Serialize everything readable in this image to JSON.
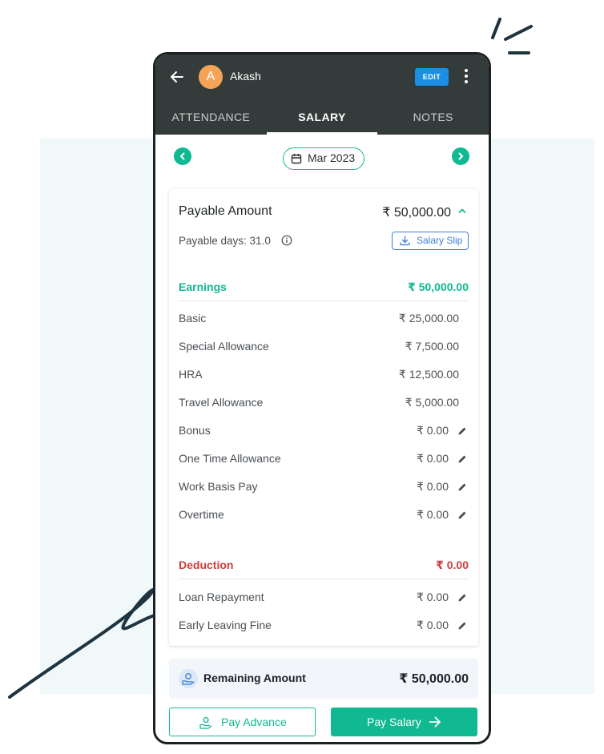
{
  "header": {
    "avatar_initial": "A",
    "user_name": "Akash",
    "edit_label": "EDIT",
    "icons": {
      "back": "arrow-left-icon",
      "menu": "more-vertical-icon"
    }
  },
  "tabs": [
    {
      "label": "ATTENDANCE",
      "active": false
    },
    {
      "label": "SALARY",
      "active": true
    },
    {
      "label": "NOTES",
      "active": false
    }
  ],
  "month_selector": {
    "label": "Mar 2023",
    "icon": "calendar-icon"
  },
  "summary": {
    "payable_label": "Payable Amount",
    "payable_amount": "₹ 50,000.00",
    "payable_days": "Payable days: 31.0",
    "salary_slip_label": "Salary Slip"
  },
  "earnings": {
    "title": "Earnings",
    "total": "₹ 50,000.00",
    "items": [
      {
        "label": "Basic",
        "amount": "₹ 25,000.00",
        "editable": false
      },
      {
        "label": "Special Allowance",
        "amount": "₹ 7,500.00",
        "editable": false
      },
      {
        "label": "HRA",
        "amount": "₹ 12,500.00",
        "editable": false
      },
      {
        "label": "Travel Allowance",
        "amount": "₹ 5,000.00",
        "editable": false
      },
      {
        "label": "Bonus",
        "amount": "₹ 0.00",
        "editable": true
      },
      {
        "label": "One Time Allowance",
        "amount": "₹ 0.00",
        "editable": true
      },
      {
        "label": "Work Basis Pay",
        "amount": "₹ 0.00",
        "editable": true
      },
      {
        "label": "Overtime",
        "amount": "₹ 0.00",
        "editable": true
      }
    ]
  },
  "deduction": {
    "title": "Deduction",
    "total": "₹ 0.00",
    "items": [
      {
        "label": "Loan Repayment",
        "amount": "₹ 0.00",
        "editable": true
      },
      {
        "label": "Early Leaving Fine",
        "amount": "₹ 0.00",
        "editable": true
      }
    ]
  },
  "remaining": {
    "label": "Remaining Amount",
    "amount": "₹ 50,000.00"
  },
  "actions": {
    "pay_advance": "Pay Advance",
    "pay_salary": "Pay Salary"
  },
  "colors": {
    "header_bg": "#343c3b",
    "accent_green": "#10b991",
    "deduction_red": "#d13b3b",
    "edit_blue": "#1a8fe3",
    "avatar_orange": "#f5a356"
  }
}
